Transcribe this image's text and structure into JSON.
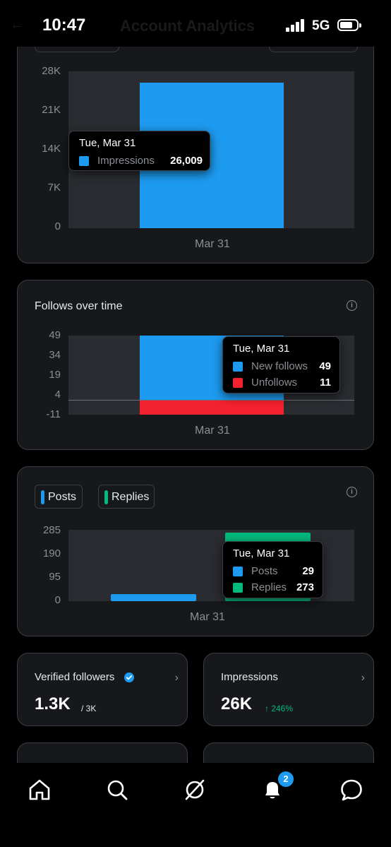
{
  "status_bar": {
    "time": "10:47",
    "network": "5G",
    "page_title": "Account Analytics"
  },
  "impressions_chart": {
    "y_ticks": [
      "28K",
      "21K",
      "14K",
      "7K",
      "0"
    ],
    "x_label": "Mar 31",
    "tooltip": {
      "date": "Tue, Mar 31",
      "series": "Impressions",
      "value": "26,009"
    }
  },
  "follows_chart": {
    "title": "Follows over time",
    "y_ticks": [
      "49",
      "34",
      "19",
      "4",
      "-11"
    ],
    "x_label": "Mar 31",
    "tooltip": {
      "date": "Tue, Mar 31",
      "row1_label": "New follows",
      "row1_value": "49",
      "row2_label": "Unfollows",
      "row2_value": "11"
    }
  },
  "posts_chart": {
    "chips": {
      "posts": "Posts",
      "replies": "Replies"
    },
    "y_ticks": [
      "285",
      "190",
      "95",
      "0"
    ],
    "x_label": "Mar 31",
    "tooltip": {
      "date": "Tue, Mar 31",
      "row1_label": "Posts",
      "row1_value": "29",
      "row2_label": "Replies",
      "row2_value": "273"
    }
  },
  "stats": {
    "verified": {
      "title": "Verified followers",
      "value": "1.3K",
      "suffix": "/ 3K"
    },
    "impressions": {
      "title": "Impressions",
      "value": "26K",
      "change": "↑ 246%"
    }
  },
  "tab_bar": {
    "notification_count": "2"
  },
  "colors": {
    "blue": "#1d9bf0",
    "red": "#f4212e",
    "green": "#00ba7c",
    "card_bg": "#16181c",
    "border": "#3a3d41"
  },
  "chart_data": [
    {
      "type": "bar",
      "categories": [
        "Mar 31"
      ],
      "series": [
        {
          "name": "Impressions",
          "values": [
            26009
          ]
        }
      ],
      "ylim": [
        0,
        28000
      ]
    },
    {
      "type": "bar",
      "categories": [
        "Mar 31"
      ],
      "series": [
        {
          "name": "New follows",
          "values": [
            49
          ]
        },
        {
          "name": "Unfollows",
          "values": [
            -11
          ]
        }
      ],
      "ylim": [
        -11,
        49
      ]
    },
    {
      "type": "bar",
      "categories": [
        "Mar 31"
      ],
      "series": [
        {
          "name": "Posts",
          "values": [
            29
          ]
        },
        {
          "name": "Replies",
          "values": [
            273
          ]
        }
      ],
      "ylim": [
        0,
        285
      ]
    }
  ]
}
